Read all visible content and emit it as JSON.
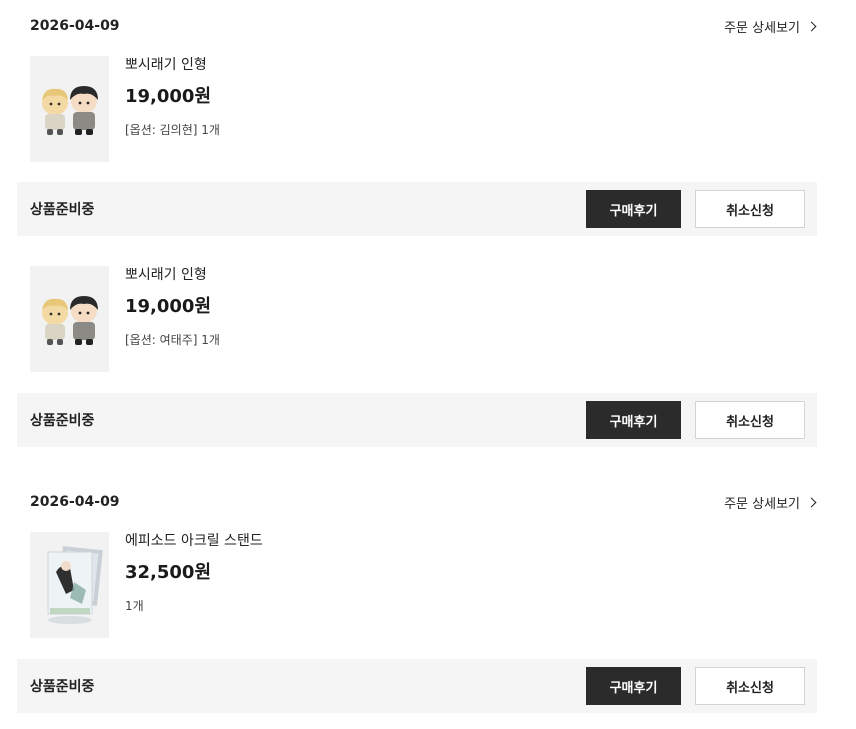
{
  "orders": [
    {
      "date": "2026-04-09",
      "detail_link": "주문 상세보기",
      "items": [
        {
          "name": "뽀시래기 인형",
          "price": "19,000원",
          "option": "[옵션: 김의현] 1개",
          "status": "상품준비중",
          "review_button": "구매후기",
          "cancel_button": "취소신청"
        },
        {
          "name": "뽀시래기 인형",
          "price": "19,000원",
          "option": "[옵션: 여태주] 1개",
          "status": "상품준비중",
          "review_button": "구매후기",
          "cancel_button": "취소신청"
        }
      ]
    },
    {
      "date": "2026-04-09",
      "detail_link": "주문 상세보기",
      "items": [
        {
          "name": "에피소드 아크릴 스탠드",
          "price": "32,500원",
          "option": "1개",
          "status": "상품준비중",
          "review_button": "구매후기",
          "cancel_button": "취소신청"
        }
      ]
    }
  ],
  "icons": {
    "detail_chevron": "chevron-right-icon",
    "doll_thumbnail": "plush-doll-image",
    "stand_thumbnail": "acrylic-stand-image"
  }
}
